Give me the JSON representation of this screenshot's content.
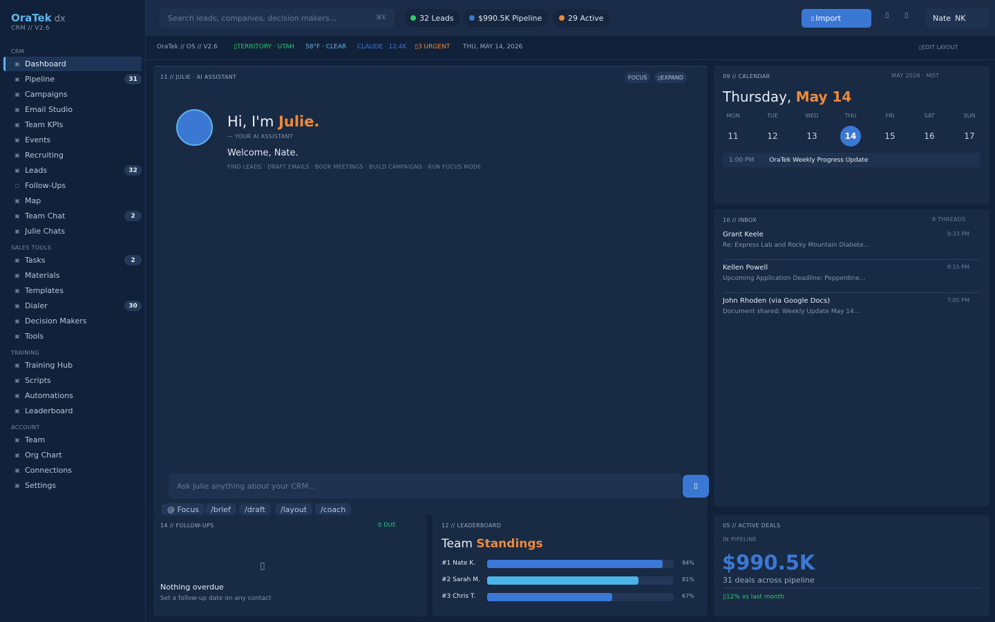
{
  "brand": {
    "name": "OraTek",
    "suffix": "dx",
    "sub": "CRM // V2.6"
  },
  "sidebar": {
    "sections": {
      "crm": "CRM",
      "sales": "SALES TOOLS",
      "training": "TRAINING",
      "account": "ACCOUNT"
    },
    "items": [
      {
        "label": "Dashboard",
        "badge": ""
      },
      {
        "label": "Pipeline",
        "badge": "31"
      },
      {
        "label": "Campaigns",
        "badge": ""
      },
      {
        "label": "Email Studio",
        "badge": ""
      },
      {
        "label": "Team KPIs",
        "badge": ""
      },
      {
        "label": "Events",
        "badge": ""
      },
      {
        "label": "Recruiting",
        "badge": ""
      },
      {
        "label": "Leads",
        "badge": "32"
      },
      {
        "label": "Follow-Ups",
        "badge": ""
      },
      {
        "label": "Map",
        "badge": ""
      },
      {
        "label": "Team Chat",
        "badge": "2"
      },
      {
        "label": "Julie Chats",
        "badge": ""
      },
      {
        "label": "Tasks",
        "badge": "2"
      },
      {
        "label": "Materials",
        "badge": ""
      },
      {
        "label": "Templates",
        "badge": ""
      },
      {
        "label": "Dialer",
        "badge": "30"
      },
      {
        "label": "Decision Makers",
        "badge": ""
      },
      {
        "label": "Tools",
        "badge": ""
      },
      {
        "label": "Training Hub",
        "badge": ""
      },
      {
        "label": "Scripts",
        "badge": ""
      },
      {
        "label": "Automations",
        "badge": ""
      },
      {
        "label": "Leaderboard",
        "badge": ""
      },
      {
        "label": "Team",
        "badge": ""
      },
      {
        "label": "Org Chart",
        "badge": ""
      },
      {
        "label": "Connections",
        "badge": ""
      },
      {
        "label": "Settings",
        "badge": ""
      }
    ]
  },
  "topbar": {
    "search_placeholder": "Search leads, companies, decision makers...",
    "search_kbd": "⌘K",
    "pills": [
      {
        "label": "32 Leads",
        "color": "#2ecc71"
      },
      {
        "label": "$990.5K Pipeline",
        "color": "#3a78d4"
      },
      {
        "label": "29 Active",
        "color": "#f08a3a"
      }
    ],
    "import_label": "Import",
    "user_name": "Nate",
    "user_initials": "NK"
  },
  "statusbar": {
    "os": "OraTek // OS // V2.6",
    "territory": "TERRITORY · UTAH",
    "weather": "58°F · CLEAR",
    "claude": "CLAUDE · 12.4K",
    "urgent": "3 URGENT",
    "date": "THU, MAY 14, 2026",
    "edit_layout": "EDIT LAYOUT"
  },
  "assistant": {
    "label": "11 // JULIE · AI ASSISTANT",
    "focus": "FOCUS",
    "expand": "EXPAND",
    "greet_prefix": "Hi, I'm",
    "greet_name": "Julie.",
    "sub": "— YOUR AI ASSISTANT",
    "welcome": "Welcome, Nate.",
    "capabilities": "FIND LEADS · DRAFT EMAILS · BOOK MEETINGS · BUILD CAMPAIGNS · RUN FOCUS MODE",
    "input_placeholder": "Ask Julie anything about your CRM...",
    "chips": [
      "@ Focus",
      "/brief",
      "/draft",
      "/layout",
      "/coach"
    ]
  },
  "calendar": {
    "label": "09 // CALENDAR",
    "month": "MAY 2026 · MDT",
    "title_prefix": "Thursday,",
    "title_date": "May 14",
    "days": [
      {
        "dow": "MON",
        "num": "11"
      },
      {
        "dow": "TUE",
        "num": "12"
      },
      {
        "dow": "WED",
        "num": "13"
      },
      {
        "dow": "THU",
        "num": "14"
      },
      {
        "dow": "FRI",
        "num": "15"
      },
      {
        "dow": "SAT",
        "num": "16"
      },
      {
        "dow": "SUN",
        "num": "17"
      }
    ],
    "event_time": "1:00 PM",
    "event_title": "OraTek Weekly Progress Update"
  },
  "inbox": {
    "label": "10 // INBOX",
    "count": "8 THREADS",
    "threads": [
      {
        "from": "Grant Keele",
        "time": "9:33 PM",
        "subject": "Re: Express Lab and Rocky Mountain Diabete..."
      },
      {
        "from": "Kellen Powell",
        "time": "8:15 PM",
        "subject": "Upcoming Application Deadline: Pepperdine..."
      },
      {
        "from": "John Rhoden (via Google Docs)",
        "time": "7:05 PM",
        "subject": "Document shared: Weekly Update May 14..."
      }
    ]
  },
  "followups": {
    "label": "14 // FOLLOW-UPS",
    "due": "0 DUE",
    "empty_title": "Nothing overdue",
    "empty_sub": "Set a follow-up date on any contact"
  },
  "leaderboard": {
    "label": "12 // LEADERBOARD",
    "title_prefix": "Team",
    "title_accent": "Standings",
    "rows": [
      {
        "name": "#1 Nate K.",
        "pct": "94%",
        "value": 0.94,
        "color": "#3a78d4"
      },
      {
        "name": "#2 Sarah M.",
        "pct": "81%",
        "value": 0.81,
        "color": "#4ab3e8"
      },
      {
        "name": "#3 Chris T.",
        "pct": "67%",
        "value": 0.67,
        "color": "#3a78d4"
      }
    ]
  },
  "deals": {
    "label": "05 // ACTIVE DEALS",
    "sub": "IN PIPELINE",
    "value": "$990.5K",
    "count": "31 deals across pipeline",
    "trend": "12% vs last month"
  }
}
